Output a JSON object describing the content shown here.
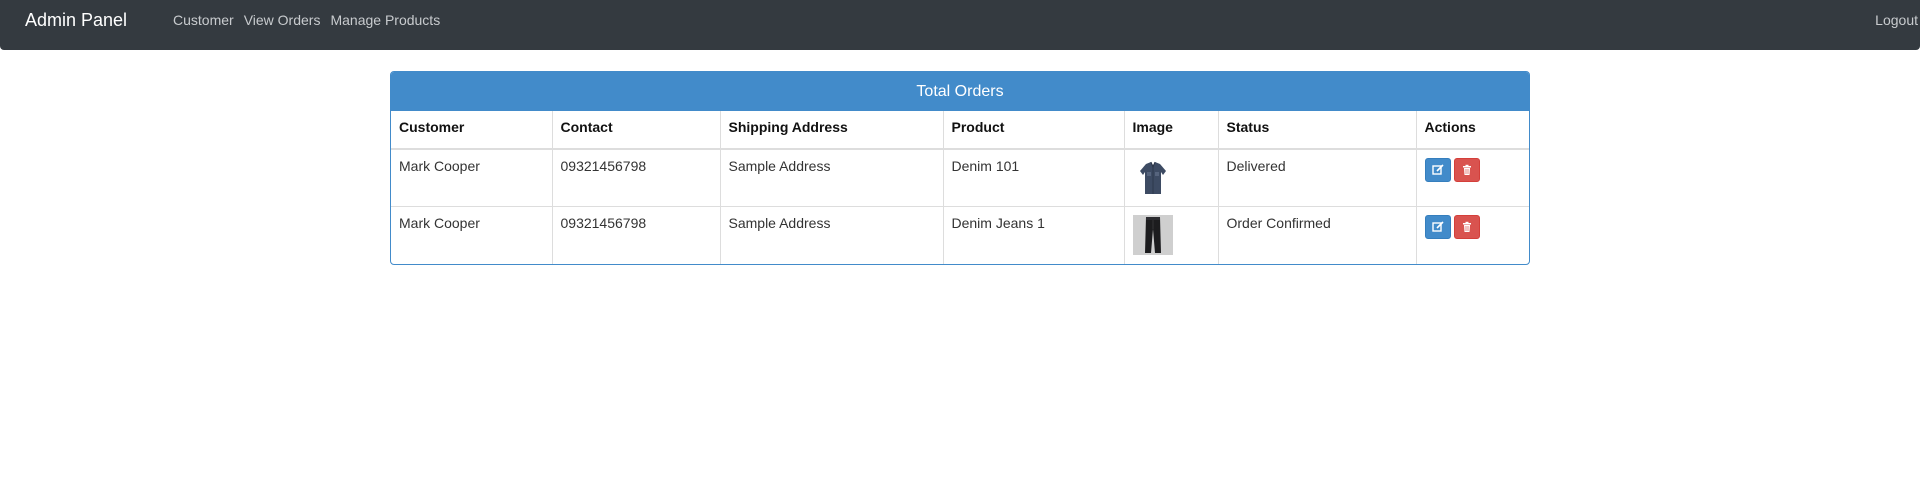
{
  "navbar": {
    "brand": "Admin Panel",
    "links": [
      "Customer",
      "View Orders",
      "Manage Products"
    ],
    "logout": "Logout"
  },
  "panel": {
    "title": "Total Orders"
  },
  "table": {
    "columns": [
      "Customer",
      "Contact",
      "Shipping Address",
      "Product",
      "Image",
      "Status",
      "Actions"
    ],
    "rows": [
      {
        "customer": "Mark Cooper",
        "contact": "09321456798",
        "address": "Sample Address",
        "product": "Denim 101",
        "image": "denim-shirt-thumbnail",
        "status": "Delivered",
        "actions": [
          "edit-icon",
          "trash-icon"
        ]
      },
      {
        "customer": "Mark Cooper",
        "contact": "09321456798",
        "address": "Sample Address",
        "product": "Denim Jeans 1",
        "image": "denim-jeans-thumbnail",
        "status": "Order Confirmed",
        "actions": [
          "edit-icon",
          "trash-icon"
        ]
      }
    ]
  },
  "colors": {
    "navbar_bg": "#343a40",
    "primary": "#428bca",
    "danger": "#d9534f"
  }
}
